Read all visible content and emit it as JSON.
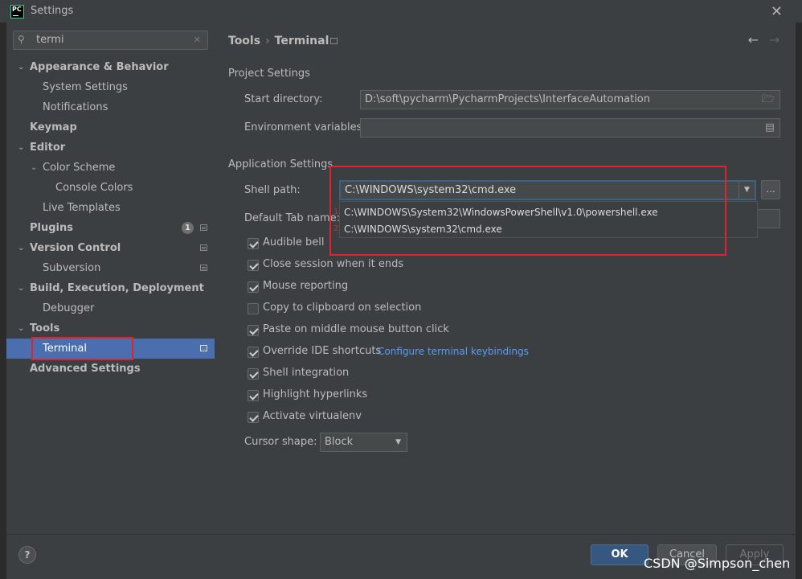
{
  "window": {
    "title": "Settings",
    "app_icon_text": "PC"
  },
  "search": {
    "value": "termi"
  },
  "sidebar": {
    "items": [
      {
        "label": "Appearance & Behavior"
      },
      {
        "label": "System Settings"
      },
      {
        "label": "Notifications"
      },
      {
        "label": "Keymap"
      },
      {
        "label": "Editor"
      },
      {
        "label": "Color Scheme"
      },
      {
        "label": "Console Colors"
      },
      {
        "label": "Live Templates"
      },
      {
        "label": "Plugins",
        "badge": "1"
      },
      {
        "label": "Version Control"
      },
      {
        "label": "Subversion"
      },
      {
        "label": "Build, Execution, Deployment"
      },
      {
        "label": "Debugger"
      },
      {
        "label": "Tools"
      },
      {
        "label": "Terminal"
      },
      {
        "label": "Advanced Settings"
      }
    ]
  },
  "breadcrumb": {
    "parent": "Tools",
    "separator": "›",
    "current": "Terminal"
  },
  "project_settings": {
    "heading": "Project Settings",
    "start_directory_label": "Start directory:",
    "start_directory_value": "D:\\soft\\pycharm\\PycharmProjects\\InterfaceAutomation",
    "env_vars_label": "Environment variables:",
    "env_vars_value": ""
  },
  "app_settings": {
    "heading": "Application Settings",
    "shell_path_label": "Shell path:",
    "shell_path_value": "C:\\WINDOWS\\system32\\cmd.exe",
    "browse_label": "...",
    "shell_options": [
      "C:\\WINDOWS\\System32\\WindowsPowerShell\\v1.0\\powershell.exe",
      "C:\\WINDOWS\\system32\\cmd.exe"
    ],
    "annotation_numbers": [
      "1",
      "2"
    ],
    "default_tab_label": "Default Tab name:",
    "checkboxes": [
      {
        "label": "Audible bell",
        "checked": true
      },
      {
        "label": "Close session when it ends",
        "checked": true
      },
      {
        "label": "Mouse reporting",
        "checked": true
      },
      {
        "label": "Copy to clipboard on selection",
        "checked": false
      },
      {
        "label": "Paste on middle mouse button click",
        "checked": true
      },
      {
        "label": "Override IDE shortcuts",
        "checked": true
      },
      {
        "label": "Shell integration",
        "checked": true
      },
      {
        "label": "Highlight hyperlinks",
        "checked": true
      },
      {
        "label": "Activate virtualenv",
        "checked": true
      }
    ],
    "keybindings_link": "Configure terminal keybindings",
    "cursor_shape_label": "Cursor shape:",
    "cursor_shape_value": "Block"
  },
  "footer": {
    "help_label": "?",
    "ok_label": "OK",
    "cancel_label": "Cancel",
    "apply_label": "Apply"
  },
  "background": {
    "link_fragment": "c",
    "number_fragment": "1"
  },
  "watermark": "CSDN @Simpson_chen",
  "colors": {
    "selection": "#4b6eaf",
    "annotation_red": "#e0242d",
    "primary_button": "#365880",
    "link": "#589df6"
  }
}
